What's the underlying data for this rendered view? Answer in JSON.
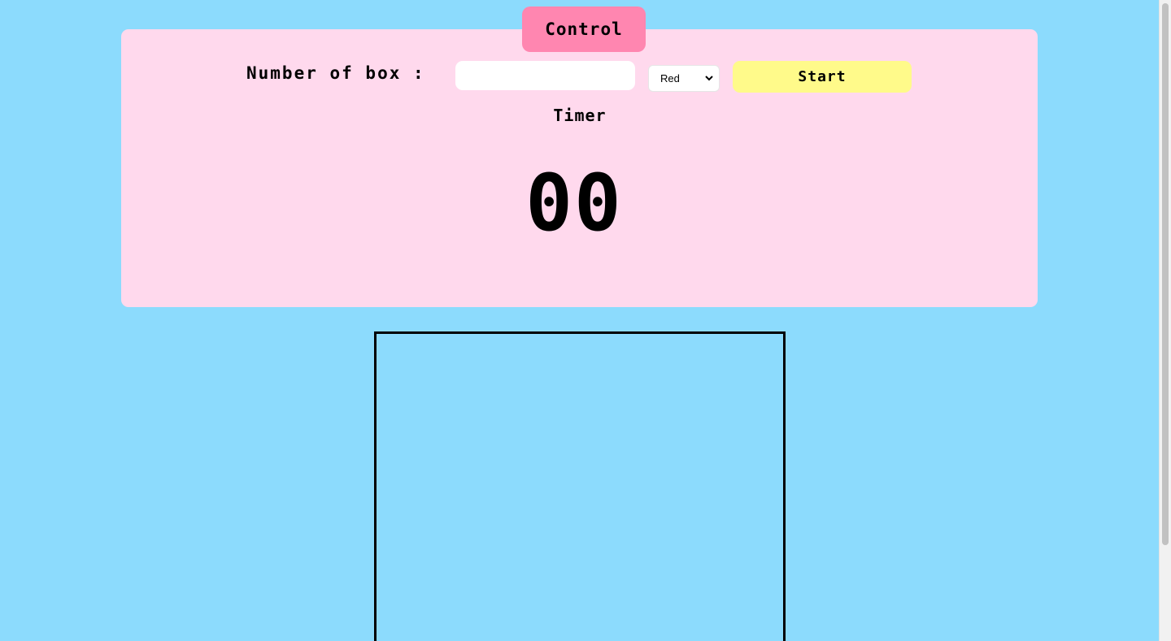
{
  "control": {
    "tab_label": "Control",
    "field_label": "Number of box :",
    "box_input": {
      "value": "",
      "placeholder": ""
    },
    "color_select": {
      "selected": "Red"
    },
    "start_label": "Start"
  },
  "timer": {
    "label": "Timer",
    "value": "00"
  },
  "colors": {
    "background": "#8cdbfd",
    "panel": "#ffd9ed",
    "tab": "#ff86b0",
    "start_button": "#fffa8a"
  },
  "icons": {
    "select_chevron": "chevron-down-icon"
  }
}
